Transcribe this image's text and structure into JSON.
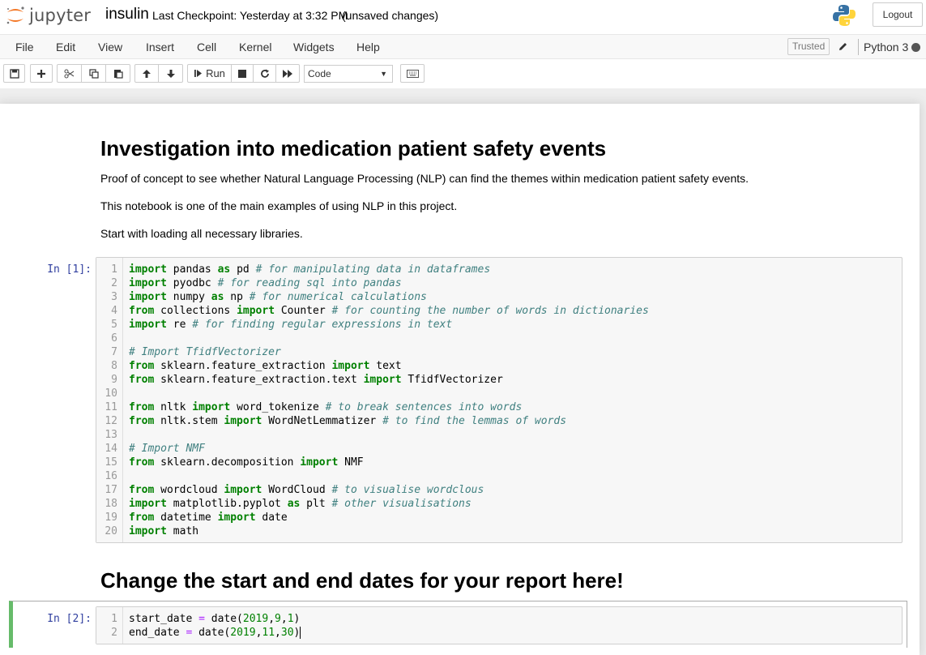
{
  "header": {
    "logo_text": "jupyter",
    "notebook_name": "insulin",
    "checkpoint": "Last Checkpoint: Yesterday at 3:32 PM",
    "autosave_status": "(unsaved changes)",
    "logout_label": "Logout"
  },
  "menubar": {
    "items": [
      "File",
      "Edit",
      "View",
      "Insert",
      "Cell",
      "Kernel",
      "Widgets",
      "Help"
    ],
    "trusted_label": "Trusted",
    "kernel_name": "Python 3"
  },
  "toolbar": {
    "run_label": "Run",
    "cell_type": "Code",
    "icons": [
      "save-icon",
      "plus-icon",
      "scissors-icon",
      "copy-icon",
      "paste-icon",
      "arrow-up-icon",
      "arrow-down-icon",
      "run-icon",
      "stop-icon",
      "restart-icon",
      "fast-forward-icon",
      "keyboard-icon"
    ]
  },
  "cells": {
    "md1": {
      "heading": "Investigation into medication patient safety events",
      "p1": "Proof of concept to see whether Natural Language Processing (NLP) can find the themes within medication patient safety events.",
      "p2": "This notebook is one of the main examples of using NLP in this project.",
      "p3": "Start with loading all necessary libraries."
    },
    "code1": {
      "prompt": "In [1]:",
      "lines": [
        "1",
        "2",
        "3",
        "4",
        "5",
        "6",
        "7",
        "8",
        "9",
        "10",
        "11",
        "12",
        "13",
        "14",
        "15",
        "16",
        "17",
        "18",
        "19",
        "20"
      ]
    },
    "md2": {
      "heading": "Change the start and end dates for your report here!"
    },
    "code2": {
      "prompt": "In [2]:",
      "lines": [
        "1",
        "2"
      ]
    }
  },
  "code_text": {
    "l1": [
      "import",
      " pandas ",
      "as",
      " pd ",
      "# for manipulating data in dataframes"
    ],
    "l2": [
      "import",
      " pyodbc ",
      "# for reading sql into pandas"
    ],
    "l3": [
      "import",
      " numpy ",
      "as",
      " np ",
      "# for numerical calculations"
    ],
    "l4": [
      "from",
      " collections ",
      "import",
      " Counter ",
      "# for counting the number of words in dictionaries"
    ],
    "l5": [
      "import",
      " re ",
      "# for finding regular expressions in text"
    ],
    "l7": [
      "# Import TfidfVectorizer"
    ],
    "l8": [
      "from",
      " sklearn.feature_extraction ",
      "import",
      " text"
    ],
    "l9": [
      "from",
      " sklearn.feature_extraction.text ",
      "import",
      " TfidfVectorizer"
    ],
    "l11": [
      "from",
      " nltk ",
      "import",
      " word_tokenize ",
      "# to break sentences into words"
    ],
    "l12": [
      "from",
      " nltk.stem ",
      "import",
      " WordNetLemmatizer ",
      "# to find the lemmas of words"
    ],
    "l14": [
      "# Import NMF"
    ],
    "l15": [
      "from",
      " sklearn.decomposition ",
      "import",
      " NMF"
    ],
    "l17": [
      "from",
      " wordcloud ",
      "import",
      " WordCloud ",
      "# to visualise wordclous"
    ],
    "l18": [
      "import",
      " matplotlib.pyplot ",
      "as",
      " plt ",
      "# other visualisations"
    ],
    "l19": [
      "from",
      " datetime ",
      "import",
      " date"
    ],
    "l20": [
      "import",
      " math"
    ],
    "s1": [
      "start_date ",
      "=",
      " date(",
      "2019",
      ",",
      "9",
      ",",
      "1",
      ")"
    ],
    "s2": [
      "end_date ",
      "=",
      " date(",
      "2019",
      ",",
      "11",
      ",",
      "30",
      ")"
    ]
  }
}
